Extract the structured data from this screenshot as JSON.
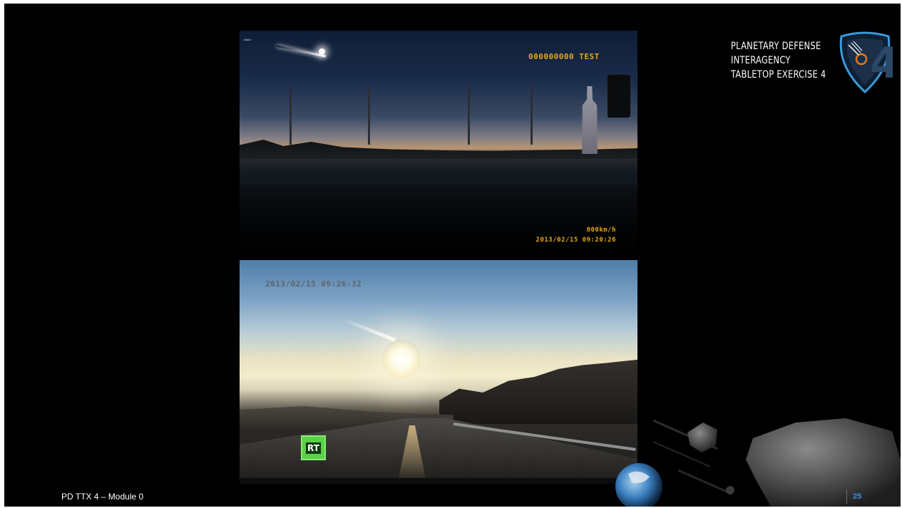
{
  "branding": {
    "title_lines": [
      "PLANETARY DEFENSE",
      "INTERAGENCY",
      "TABLETOP EXERCISE 4"
    ],
    "logo_icon": "planetary-defense-shield-logo"
  },
  "video_top": {
    "counter_text": "000000000 TEST",
    "speed_text": "000km/h",
    "date_text": "2013/02/15 09:20:26"
  },
  "video_bottom": {
    "timestamp_text": "2013/02/15 09:26:32",
    "channel_logo_text": "RT",
    "channel_logo_color": "#5bd04a"
  },
  "footer": {
    "label": "PD TTX 4 – Module 0",
    "page_number": "25",
    "page_number_color": "#3a8ee0"
  },
  "colors": {
    "slide_background": "#000000",
    "overlay_text": "#e2a51f"
  }
}
